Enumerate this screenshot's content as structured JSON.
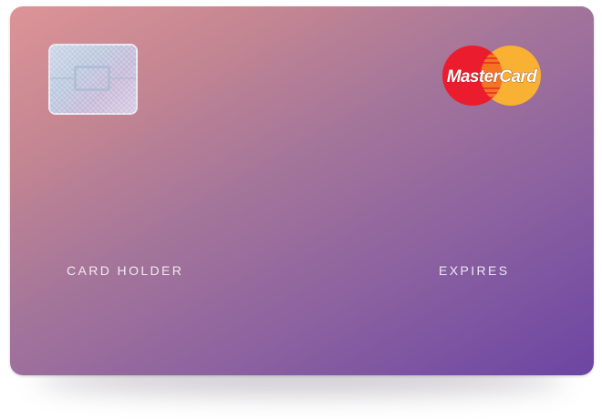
{
  "card": {
    "holder_label": "CARD HOLDER",
    "expires_label": "EXPIRES",
    "brand": {
      "name": "MasterCard",
      "icon": "mastercard-logo",
      "colors": {
        "red": "#eb1c2d",
        "orange": "#f8b133",
        "overlap": "#f47422"
      }
    },
    "chip_icon": "emv-chip-icon",
    "gradient": {
      "start": "#dd9497",
      "end": "#6c45a3"
    }
  }
}
